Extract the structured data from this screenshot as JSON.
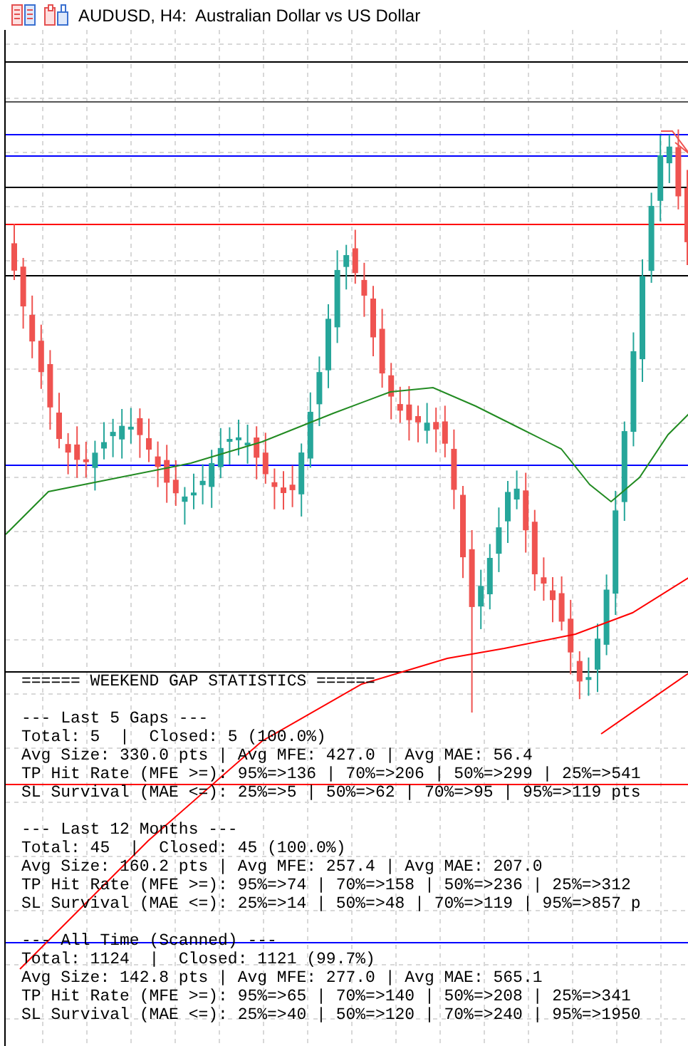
{
  "window": {
    "title": "AUDUSD, H4:  Australian Dollar vs US Dollar"
  },
  "stats": {
    "heading": "====== WEEKEND GAP STATISTICS ======",
    "sections": [
      {
        "title": "--- Last 5 Gaps ---",
        "lines": [
          "Total: 5  |  Closed: 5 (100.0%)",
          "Avg Size: 330.0 pts | Avg MFE: 427.0 | Avg MAE: 56.4",
          "TP Hit Rate (MFE >=): 95%=>136 | 70%=>206 | 50%=>299 | 25%=>541",
          "SL Survival (MAE <=): 25%=>5 | 50%=>62 | 70%=>95 | 95%=>119 pts"
        ]
      },
      {
        "title": "--- Last 12 Months ---",
        "lines": [
          "Total: 45  |  Closed: 45 (100.0%)",
          "Avg Size: 160.2 pts | Avg MFE: 257.4 | Avg MAE: 207.0",
          "TP Hit Rate (MFE >=): 95%=>74 | 70%=>158 | 50%=>236 | 25%=>312",
          "SL Survival (MAE <=): 25%=>14 | 50%=>48 | 70%=>119 | 95%=>857 p"
        ]
      },
      {
        "title": "--- All Time (Scanned) ---",
        "lines": [
          "Total: 1124  |  Closed: 1121 (99.7%)",
          "Avg Size: 142.8 pts | Avg MFE: 277.0 | Avg MAE: 565.1",
          "TP Hit Rate (MFE >=): 95%=>65 | 70%=>140 | 50%=>208 | 25%=>341",
          "SL Survival (MAE <=): 25%=>40 | 50%=>120 | 70%=>240 | 95%=>1950"
        ]
      }
    ]
  }
}
